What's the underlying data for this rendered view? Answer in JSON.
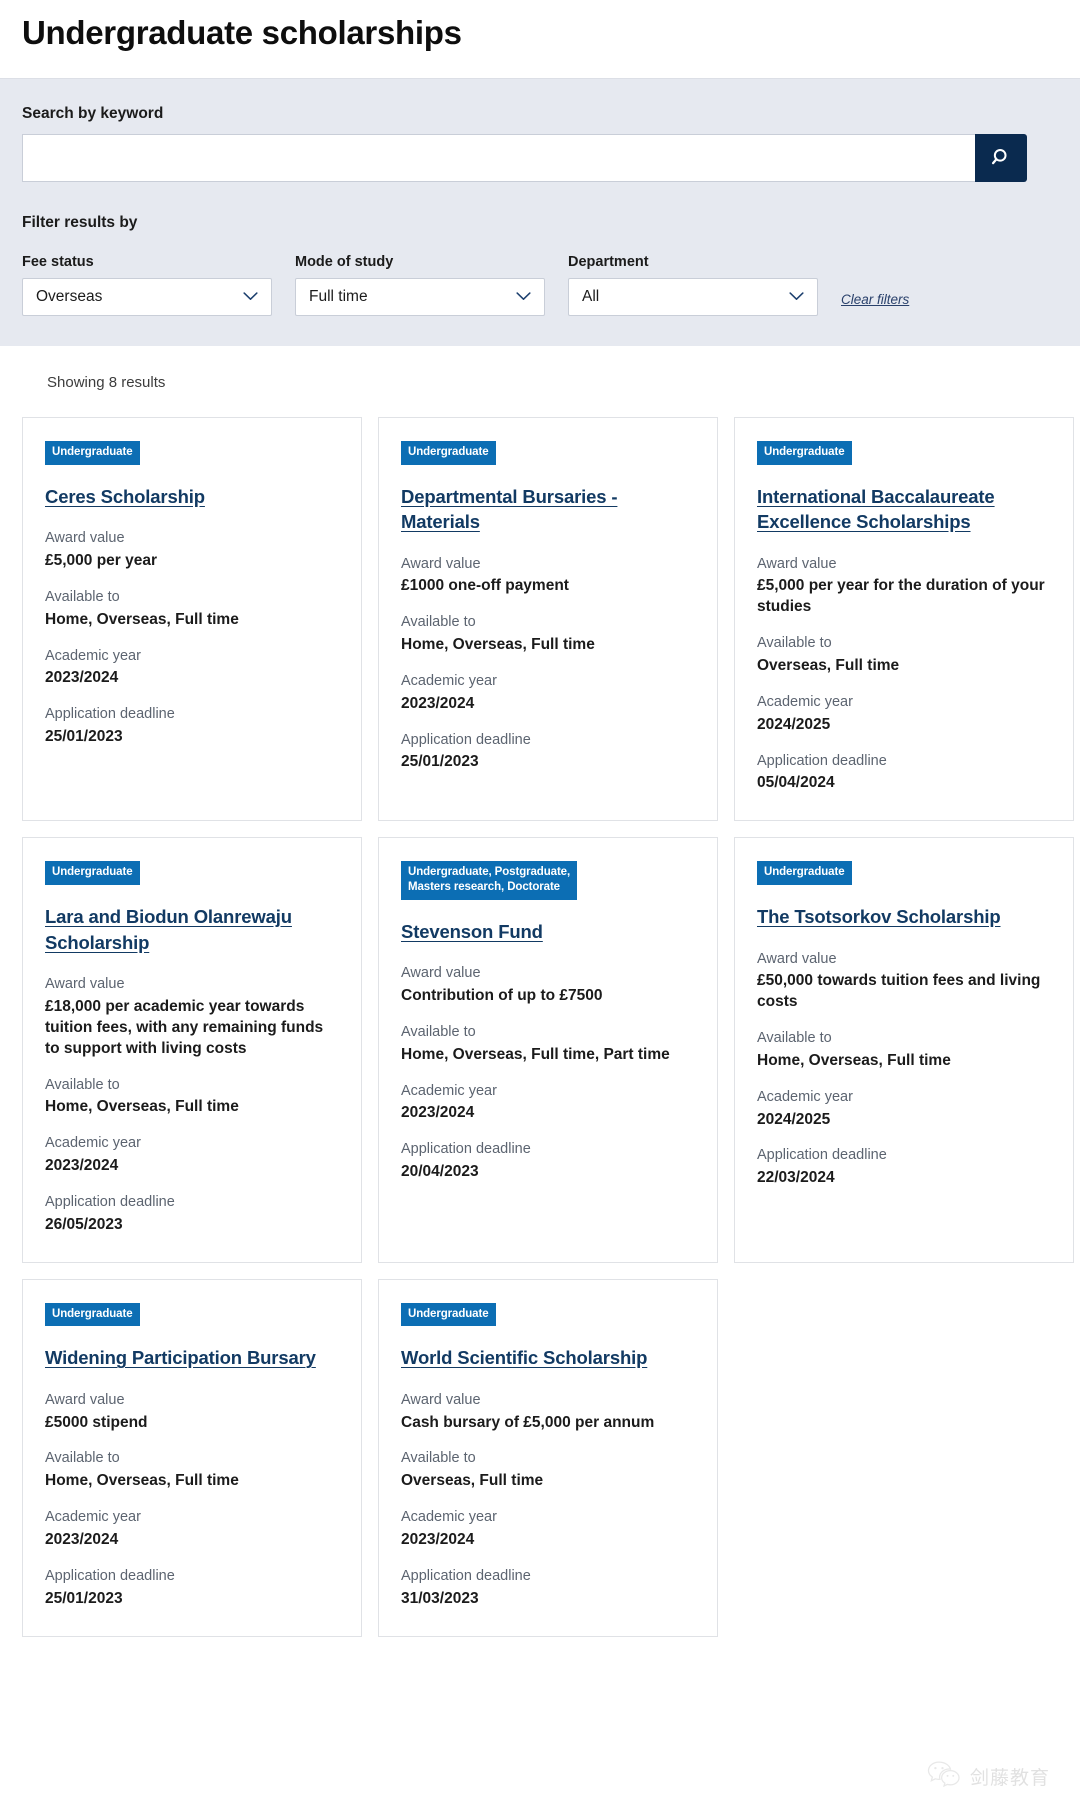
{
  "header": {
    "title": "Undergraduate scholarships"
  },
  "search": {
    "label": "Search by keyword",
    "value": "",
    "placeholder": "",
    "button_icon": "search-icon"
  },
  "filters": {
    "heading": "Filter results by",
    "clear_label": "Clear filters",
    "fields": [
      {
        "label": "Fee status",
        "value": "Overseas",
        "icon": "chevron-down-icon"
      },
      {
        "label": "Mode of study",
        "value": "Full time",
        "icon": "chevron-down-icon"
      },
      {
        "label": "Department",
        "value": "All",
        "icon": "chevron-down-icon"
      }
    ]
  },
  "results": {
    "count_text": "Showing 8 results",
    "labels": {
      "award": "Award value",
      "available": "Available to",
      "year": "Academic year",
      "deadline": "Application deadline"
    },
    "cards": [
      {
        "badge": "Undergraduate",
        "title": "Ceres Scholarship",
        "award": "£5,000 per year",
        "available": "Home, Overseas, Full time",
        "year": "2023/2024",
        "deadline": "25/01/2023"
      },
      {
        "badge": "Undergraduate",
        "title": "Departmental Bursaries - Materials",
        "award": "£1000 one-off payment",
        "available": "Home, Overseas, Full time",
        "year": "2023/2024",
        "deadline": "25/01/2023"
      },
      {
        "badge": "Undergraduate",
        "title": "International Baccalaureate Excellence Scholarships",
        "award": "£5,000 per year for the duration of your studies",
        "available": "Overseas, Full time",
        "year": "2024/2025",
        "deadline": "05/04/2024"
      },
      {
        "badge": "Undergraduate",
        "title": "Lara and Biodun Olanrewaju Scholarship",
        "award": "£18,000 per academic year towards tuition fees, with any remaining funds to support with living costs",
        "available": "Home, Overseas, Full time",
        "year": "2023/2024",
        "deadline": "26/05/2023"
      },
      {
        "badge": "Undergraduate, Postgraduate,\nMasters research, Doctorate",
        "title": "Stevenson Fund",
        "award": "Contribution of up to £7500",
        "available": "Home, Overseas, Full time, Part time",
        "year": "2023/2024",
        "deadline": "20/04/2023"
      },
      {
        "badge": "Undergraduate",
        "title": "The Tsotsorkov Scholarship",
        "award": "£50,000 towards tuition fees and living costs",
        "available": "Home, Overseas, Full time",
        "year": "2024/2025",
        "deadline": "22/03/2024"
      },
      {
        "badge": "Undergraduate",
        "title": "Widening Participation Bursary",
        "award": "£5000 stipend",
        "available": "Home, Overseas, Full time",
        "year": "2023/2024",
        "deadline": "25/01/2023"
      },
      {
        "badge": "Undergraduate",
        "title": "World Scientific Scholarship",
        "award": "Cash bursary of £5,000 per annum",
        "available": "Overseas, Full time",
        "year": "2023/2024",
        "deadline": "31/03/2023"
      }
    ]
  },
  "watermark": {
    "text": "剑藤教育",
    "icon": "wechat-icon"
  },
  "colors": {
    "accent_badge": "#0c6eb4",
    "search_button": "#0a2a4f",
    "link": "#123a63",
    "panel_bg": "#e6e9f0"
  }
}
